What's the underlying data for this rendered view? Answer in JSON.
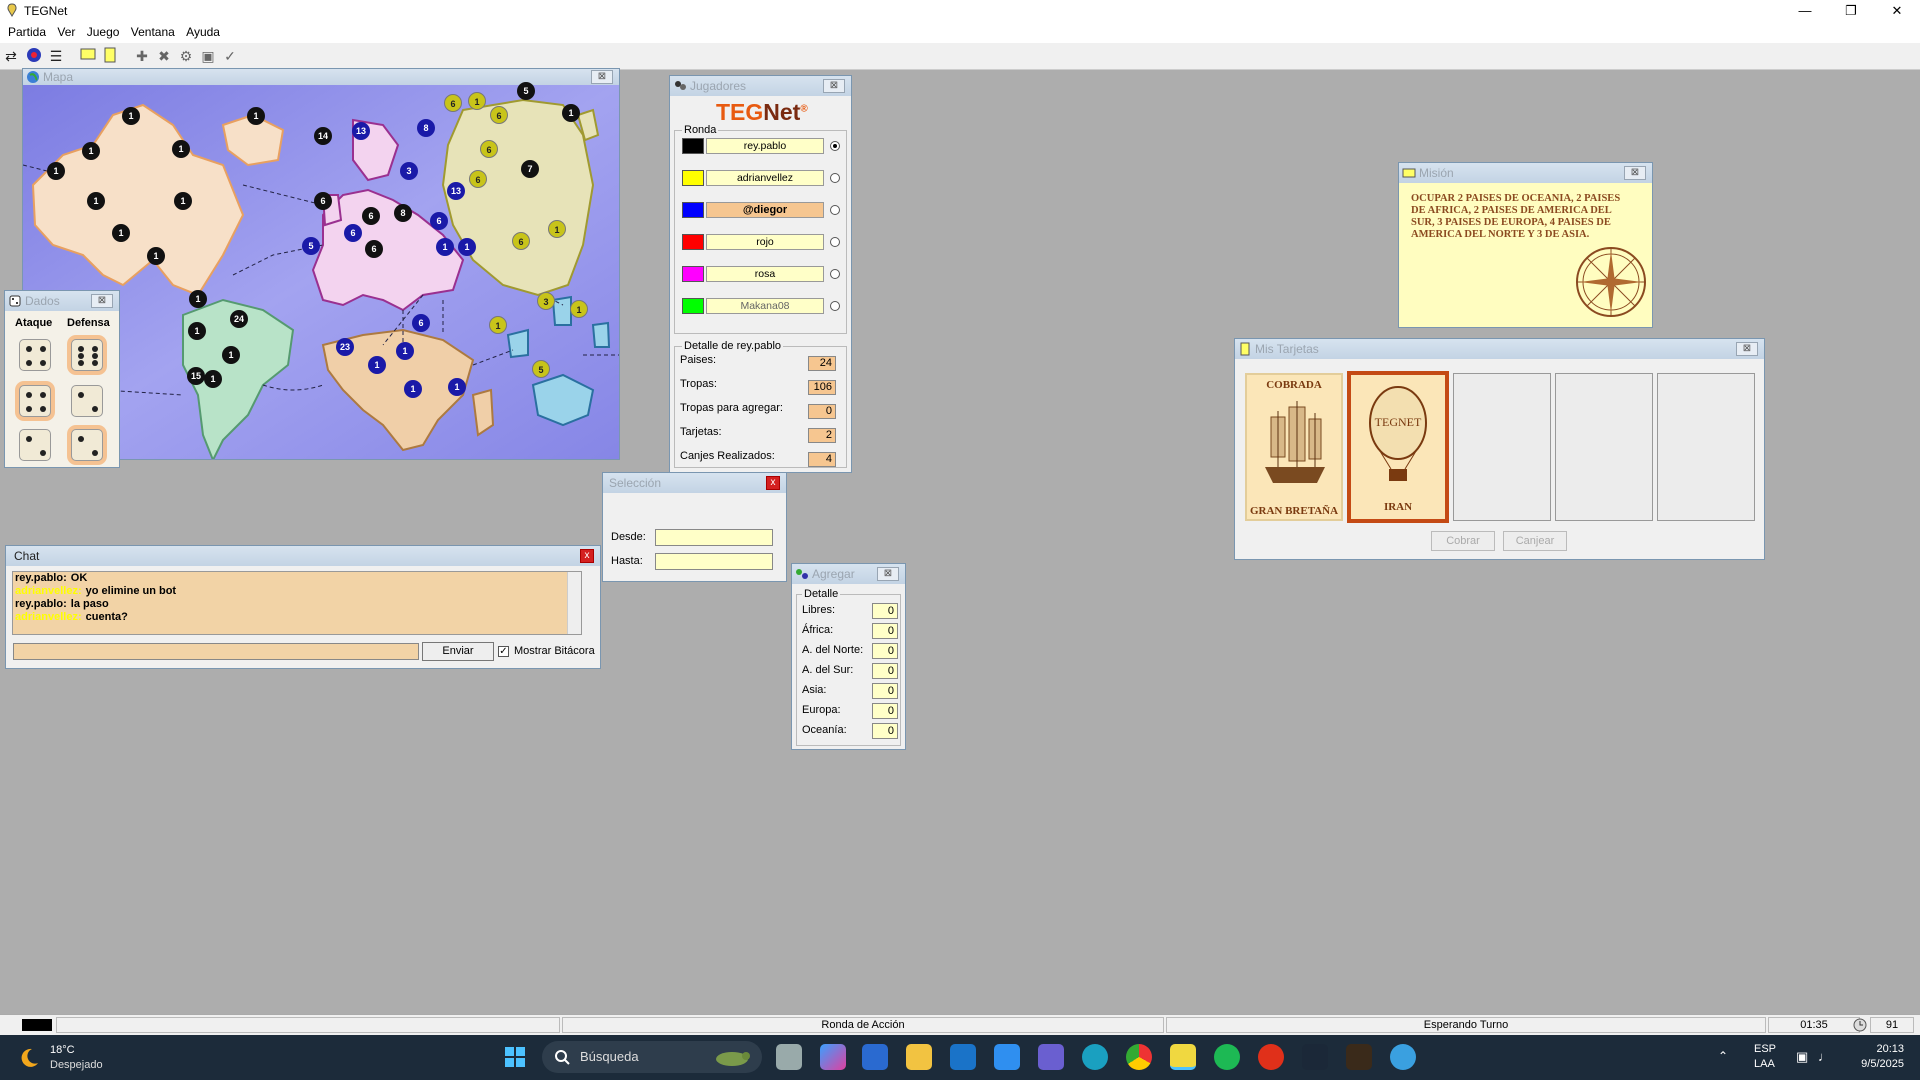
{
  "app": {
    "title": "TEGNet"
  },
  "menu": {
    "items": [
      "Partida",
      "Ver",
      "Juego",
      "Ventana",
      "Ayuda"
    ]
  },
  "mapa": {
    "title": "Mapa",
    "tokens": [
      {
        "v": "1",
        "c": "k"
      },
      {
        "v": "1",
        "c": "k"
      },
      {
        "v": "1",
        "c": "k"
      },
      {
        "v": "1",
        "c": "k"
      },
      {
        "v": "1",
        "c": "k"
      },
      {
        "v": "1",
        "c": "k"
      },
      {
        "v": "1",
        "c": "k"
      },
      {
        "v": "1",
        "c": "k"
      },
      {
        "v": "1",
        "c": "k"
      },
      {
        "v": "14",
        "c": "k"
      },
      {
        "v": "13",
        "c": "b"
      },
      {
        "v": "8",
        "c": "b"
      },
      {
        "v": "3",
        "c": "b"
      },
      {
        "v": "13",
        "c": "b"
      },
      {
        "v": "6",
        "c": "k"
      },
      {
        "v": "6",
        "c": "k"
      },
      {
        "v": "8",
        "c": "k"
      },
      {
        "v": "6",
        "c": "b"
      },
      {
        "v": "6",
        "c": "b"
      },
      {
        "v": "5",
        "c": "b"
      },
      {
        "v": "6",
        "c": "k"
      },
      {
        "v": "1",
        "c": "b"
      },
      {
        "v": "1",
        "c": "b"
      },
      {
        "v": "6",
        "c": "y"
      },
      {
        "v": "1",
        "c": "y"
      },
      {
        "v": "6",
        "c": "y"
      },
      {
        "v": "5",
        "c": "k"
      },
      {
        "v": "1",
        "c": "k"
      },
      {
        "v": "6",
        "c": "y"
      },
      {
        "v": "6",
        "c": "y"
      },
      {
        "v": "7",
        "c": "k"
      },
      {
        "v": "6",
        "c": "y"
      },
      {
        "v": "1",
        "c": "y"
      },
      {
        "v": "1",
        "c": "k"
      },
      {
        "v": "24",
        "c": "k"
      },
      {
        "v": "1",
        "c": "k"
      },
      {
        "v": "1",
        "c": "k"
      },
      {
        "v": "15",
        "c": "k"
      },
      {
        "v": "1",
        "c": "k"
      },
      {
        "v": "23",
        "c": "b"
      },
      {
        "v": "6",
        "c": "b"
      },
      {
        "v": "1",
        "c": "b"
      },
      {
        "v": "1",
        "c": "b"
      },
      {
        "v": "1",
        "c": "b"
      },
      {
        "v": "1",
        "c": "b"
      },
      {
        "v": "1",
        "c": "y"
      },
      {
        "v": "3",
        "c": "y"
      },
      {
        "v": "1",
        "c": "y"
      },
      {
        "v": "5",
        "c": "y"
      }
    ]
  },
  "dados": {
    "title": "Dados",
    "ataque": "Ataque",
    "defensa": "Defensa"
  },
  "jugadores": {
    "title": "Jugadores",
    "logo": "TEG",
    "logo_net": "Net",
    "logo_mark": "®",
    "ronda": "Ronda",
    "players": [
      {
        "name": "rey.pablo",
        "color": "#000000",
        "selected": true
      },
      {
        "name": "adrianvellez",
        "color": "#ffff00",
        "selected": false
      },
      {
        "name": "@diegor",
        "color": "#0000ff",
        "selected": false
      },
      {
        "name": "rojo",
        "color": "#ff0000",
        "selected": false
      },
      {
        "name": "rosa",
        "color": "#ff00ff",
        "selected": false
      },
      {
        "name": "Makana08",
        "color": "#00ff00",
        "selected": false
      }
    ],
    "detalle_title": "Detalle de rey.pablo",
    "detalle": [
      {
        "label": "Paises:",
        "value": "24"
      },
      {
        "label": "Tropas:",
        "value": "106"
      },
      {
        "label": "Tropas para agregar:",
        "value": "0"
      },
      {
        "label": "Tarjetas:",
        "value": "2"
      },
      {
        "label": "Canjes Realizados:",
        "value": "4"
      }
    ]
  },
  "mision": {
    "title": "Misión",
    "text": "OCUPAR 2 PAISES DE OCEANIA, 2 PAISES DE AFRICA, 2 PAISES DE AMERICA DEL SUR, 3 PAISES DE EUROPA, 4 PAISES DE AMERICA DEL NORTE Y 3 DE ASIA."
  },
  "tarjetas": {
    "title": "Mis Tarjetas",
    "cards": [
      {
        "top": "COBRADA",
        "bottom": "GRAN BRETAÑA"
      },
      {
        "top": "TEGNET",
        "bottom": "IRAN"
      }
    ],
    "cobrar": "Cobrar",
    "canjear": "Canjear"
  },
  "seleccion": {
    "title": "Selección",
    "close": "x",
    "desde": "Desde:",
    "hasta": "Hasta:"
  },
  "chat": {
    "title": "Chat",
    "close": "x",
    "lines": [
      {
        "who": "rey.pablo:",
        "msg": "OK",
        "c": "#000000"
      },
      {
        "who": "adrianvellez:",
        "msg": "yo elimine un bot",
        "c": "#ffff00"
      },
      {
        "who": "rey.pablo:",
        "msg": "la paso",
        "c": "#000000"
      },
      {
        "who": "adrianvellez:",
        "msg": "cuenta?",
        "c": "#ffff00"
      }
    ],
    "send": "Enviar",
    "show_log": "Mostrar Bitácora",
    "check_mark": "✓"
  },
  "agregar": {
    "title": "Agregar",
    "detalle": "Detalle",
    "rows": [
      {
        "label": "Libres:",
        "value": "0"
      },
      {
        "label": "África:",
        "value": "0"
      },
      {
        "label": "A. del Norte:",
        "value": "0"
      },
      {
        "label": "A. del Sur:",
        "value": "0"
      },
      {
        "label": "Asia:",
        "value": "0"
      },
      {
        "label": "Europa:",
        "value": "0"
      },
      {
        "label": "Oceanía:",
        "value": "0"
      }
    ]
  },
  "status": {
    "ronda": "Ronda de Acción",
    "estado": "Esperando Turno",
    "time": "01:35",
    "num": "91"
  },
  "taskbar": {
    "temp": "18°C",
    "weather": "Despejado",
    "search": "Búsqueda",
    "lang1": "ESP",
    "lang2": "LAA",
    "clock": "20:13",
    "date": "9/5/2025"
  }
}
